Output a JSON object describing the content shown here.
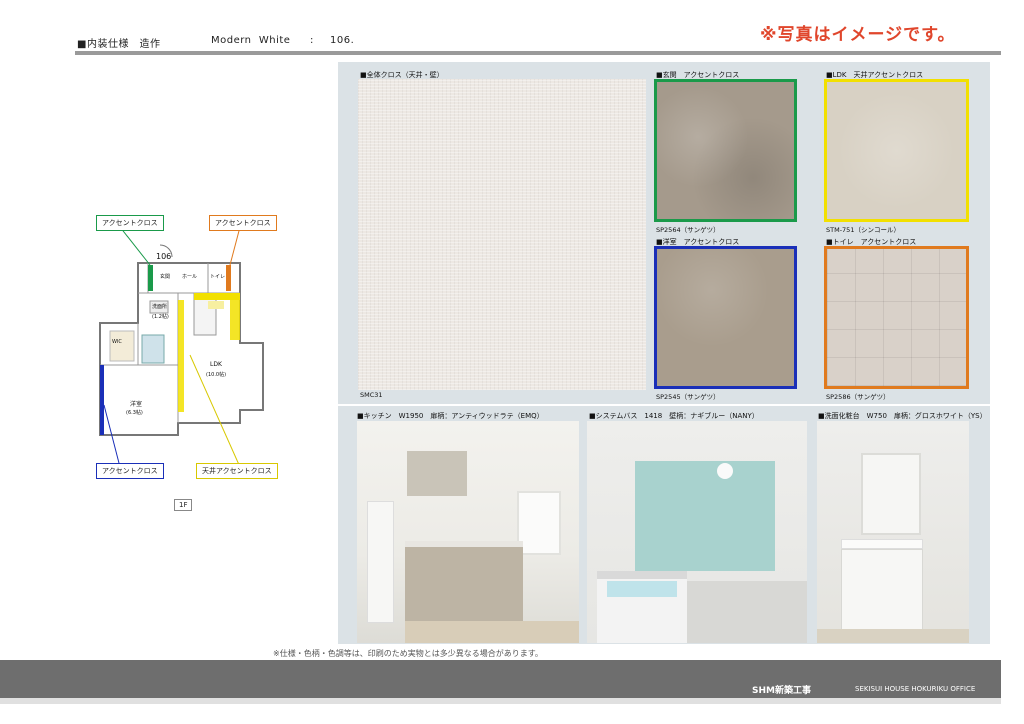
{
  "header": {
    "spec_title": "■内装仕様　造作",
    "theme": "Modern  White",
    "separator": ":",
    "room_number": "106.",
    "image_note": "※写真はイメージです。"
  },
  "floorplan": {
    "callout_entry": "アクセントクロス",
    "callout_toilet": "アクセントクロス",
    "callout_bedroom": "アクセントクロス",
    "callout_ceiling": "天井アクセントクロス",
    "unit_label": "106",
    "floor_label": "1F",
    "room_entry": "玄関",
    "room_hall": "ホール",
    "room_toilet": "トイレ",
    "room_wash": "洗面所",
    "room_wash_size": "(1.2帖)",
    "room_wic": "WIC",
    "room_ldk": "LDK",
    "room_ldk_size": "(10.0帖)",
    "room_western": "洋室",
    "room_western_size": "(6.3帖)",
    "colors": {
      "green": "#1a9a4a",
      "orange": "#e07a1e",
      "blue": "#1a2fb8",
      "yellow": "#f2e000"
    }
  },
  "materials": {
    "main_label": "■全体クロス（天井・壁）",
    "main_code": "SMC31",
    "entry_label": "■玄関　アクセントクロス",
    "entry_code": "SP2564（サンゲツ）",
    "ldk_label": "■LDK　天井アクセントクロス",
    "ldk_code": "STM-751（シンコール）",
    "western_label": "■洋室　アクセントクロス",
    "western_code": "SP2545（サンゲツ）",
    "toilet_label": "■トイレ　アクセントクロス",
    "toilet_code": "SP2586（サンゲツ）"
  },
  "equipment": {
    "kitchen": "■キッチン　W1950　扉柄：アンティウッドラテ（EMQ）",
    "bath": "■システムバス　1418　壁柄：ナギブルー（NANY）",
    "vanity": "■洗面化粧台　W750　扉柄：グロスホワイト（YS）"
  },
  "disclaimer": "※仕様・色柄・色調等は、印刷のため実物とは多少異なる場合があります。",
  "footer": {
    "company_jp": "SHM新築工事",
    "company_en": "SEKISUI HOUSE HOKURIKU OFFICE"
  }
}
